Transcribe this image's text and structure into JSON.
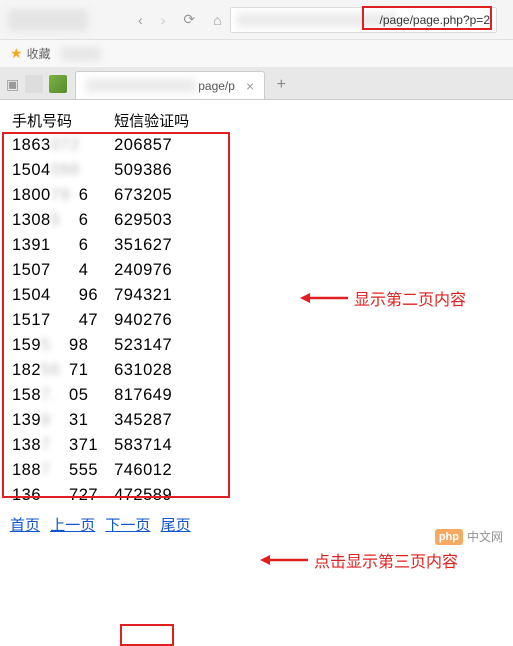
{
  "browser": {
    "url_suffix": "/page/page.php?p=2",
    "bookmark_label": "收藏",
    "tab_title": "page/p",
    "tab_close": "×",
    "new_tab": "+"
  },
  "table": {
    "headers": [
      "手机号码",
      "短信验证吗"
    ],
    "rows": [
      {
        "phone_prefix": "1863",
        "phone_mid": "072",
        "phone_suffix": "",
        "code": "206857"
      },
      {
        "phone_prefix": "1504",
        "phone_mid": "098",
        "phone_suffix": "",
        "code": "509386"
      },
      {
        "phone_prefix": "1800",
        "phone_mid": "79",
        "phone_suffix": "6",
        "code": "673205"
      },
      {
        "phone_prefix": "1308",
        "phone_mid": "5",
        "phone_suffix": "6",
        "code": "629503"
      },
      {
        "phone_prefix": "1391",
        "phone_mid": "",
        "phone_suffix": "6",
        "code": "351627"
      },
      {
        "phone_prefix": "1507",
        "phone_mid": "",
        "phone_suffix": "4",
        "code": "240976"
      },
      {
        "phone_prefix": "1504",
        "phone_mid": "",
        "phone_suffix": "96",
        "code": "794321"
      },
      {
        "phone_prefix": "1517",
        "phone_mid": "",
        "phone_suffix": "47",
        "code": "940276"
      },
      {
        "phone_prefix": "159",
        "phone_mid": "5",
        "phone_suffix": "98",
        "code": "523147"
      },
      {
        "phone_prefix": "182",
        "phone_mid": "56",
        "phone_suffix": "71",
        "code": "631028"
      },
      {
        "phone_prefix": "158",
        "phone_mid": "7.",
        "phone_suffix": "05",
        "code": "817649"
      },
      {
        "phone_prefix": "139",
        "phone_mid": "9",
        "phone_suffix": "31",
        "code": "345287"
      },
      {
        "phone_prefix": "138",
        "phone_mid": "7",
        "phone_suffix": "371",
        "code": "583714"
      },
      {
        "phone_prefix": "188",
        "phone_mid": "7",
        "phone_suffix": "555",
        "code": "746012"
      },
      {
        "phone_prefix": "136",
        "phone_mid": "",
        "phone_suffix": "727",
        "code": "472589"
      }
    ]
  },
  "pagination": {
    "first": "首页",
    "prev": "上一页",
    "next": "下一页",
    "last": "尾页"
  },
  "annotations": {
    "page2": "显示第二页内容",
    "click_page3": "点击显示第三页内容"
  },
  "watermark": {
    "logo": "php",
    "text": "中文网"
  },
  "colors": {
    "highlight": "#e02020",
    "link": "#1155cc"
  }
}
